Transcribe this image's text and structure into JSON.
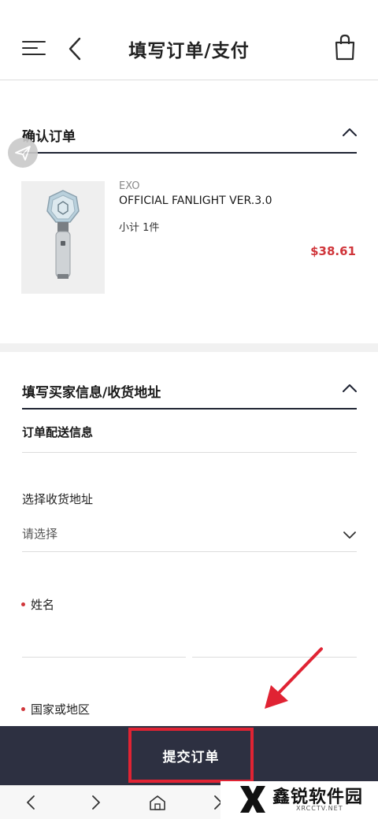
{
  "header": {
    "title": "填写订单/支付"
  },
  "confirm_section": {
    "title": "确认订单",
    "product": {
      "brand": "EXO",
      "name": "OFFICIAL FANLIGHT VER.3.0",
      "subtotal_qty": "小计 1件",
      "price": "$38.61"
    }
  },
  "buyer_section": {
    "title": "填写买家信息/收货地址",
    "delivery_title": "订单配送信息",
    "address_label": "选择收货地址",
    "address_placeholder": "请选择",
    "name_label": "姓名",
    "country_label": "国家或地区"
  },
  "submit": {
    "label": "提交订单"
  },
  "watermark": {
    "text": "鑫锐软件园",
    "sub": "XRCCTV.NET"
  },
  "colors": {
    "accent_red": "#d0353a",
    "bar_navy": "#2d3041",
    "highlight_red": "#e02333"
  },
  "icons": [
    "menu-icon",
    "back-arrow-icon",
    "shopping-bag-icon",
    "chevron-up-icon",
    "chevron-down-icon",
    "send-icon",
    "home-icon",
    "forward-icon"
  ]
}
